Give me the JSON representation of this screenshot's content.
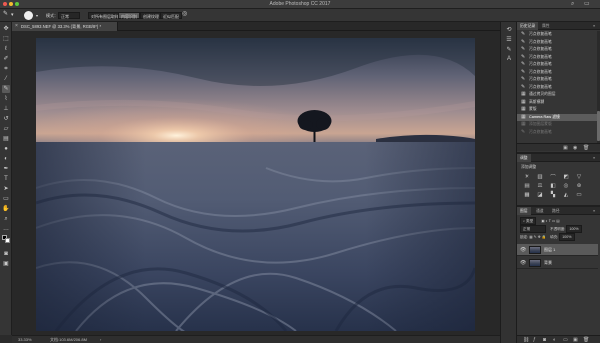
{
  "window": {
    "app_title": "Adobe Photoshop CC 2017"
  },
  "options_bar": {
    "mode_label": "模式：",
    "mode_value": "正常",
    "btn_1": "对所有图层取样",
    "btn_2": "内容识别",
    "btn_3": "创建纹理",
    "btn_4": "近似匹配"
  },
  "document": {
    "tab_label": "DSC_5893.NEF @ 33.3% (背景, RGB/8*) *",
    "zoom": "33.33%",
    "doc_info": "文档:103.6M/206.8M"
  },
  "history": {
    "tab_1": "历史记录",
    "tab_2": "属性",
    "items": [
      {
        "label": "污点修复画笔",
        "state": "normal"
      },
      {
        "label": "污点修复画笔",
        "state": "normal"
      },
      {
        "label": "污点修复画笔",
        "state": "normal"
      },
      {
        "label": "污点修复画笔",
        "state": "normal"
      },
      {
        "label": "污点修复画笔",
        "state": "normal"
      },
      {
        "label": "污点修复画笔",
        "state": "normal"
      },
      {
        "label": "污点修复画笔",
        "state": "normal"
      },
      {
        "label": "污点修复画笔",
        "state": "normal"
      },
      {
        "label": "通过拷贝的图层",
        "state": "normal"
      },
      {
        "label": "高斯模糊",
        "state": "normal"
      },
      {
        "label": "蒙版",
        "state": "normal"
      },
      {
        "label": "Camera Raw 滤镜",
        "state": "selected"
      },
      {
        "label": "添加图层蒙版",
        "state": "dim"
      },
      {
        "label": "污点修复画笔",
        "state": "dim"
      }
    ]
  },
  "adjustments": {
    "tab": "调整",
    "subtitle": "添加调整",
    "icons": [
      "brightness-icon",
      "levels-icon",
      "curves-icon",
      "exposure-icon",
      "vibrance-icon",
      "hue-icon",
      "colorbalance-icon",
      "bw-icon",
      "photofilter-icon",
      "channelmixer-icon",
      "lookup-icon",
      "invert-icon",
      "posterize-icon",
      "threshold-icon",
      "gradientmap-icon"
    ]
  },
  "layers": {
    "tab_1": "图层",
    "tab_2": "通道",
    "tab_3": "路径",
    "kind_label": "类型",
    "blend_mode": "正常",
    "opacity_label": "不透明度:",
    "opacity_value": "100%",
    "lock_label": "锁定:",
    "fill_label": "填充:",
    "fill_value": "100%",
    "items": [
      {
        "name": "图层 1",
        "visible": true,
        "selected": true
      },
      {
        "name": "背景",
        "visible": true,
        "selected": false
      }
    ]
  },
  "colors": {
    "foreground": "#000000",
    "background": "#ffffff",
    "selection_highlight": "#5c5c5c"
  }
}
